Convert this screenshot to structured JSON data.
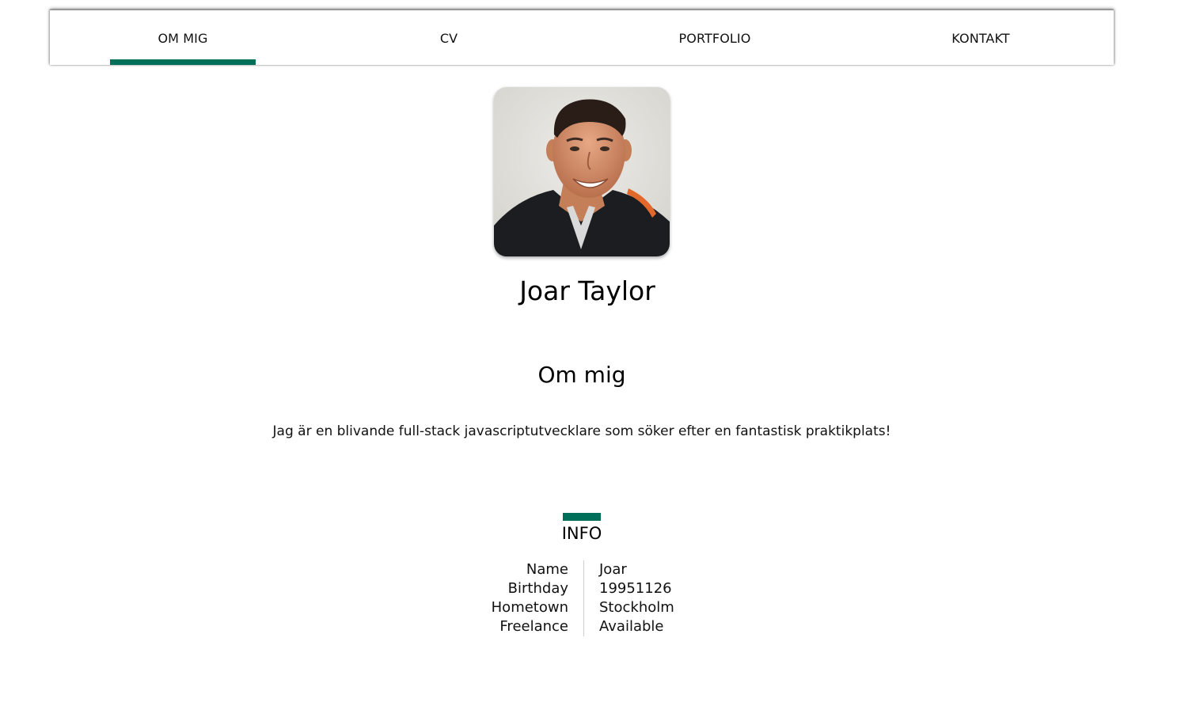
{
  "nav": {
    "items": [
      {
        "label": "OM MIG",
        "active": true
      },
      {
        "label": "CV",
        "active": false
      },
      {
        "label": "PORTFOLIO",
        "active": false
      },
      {
        "label": "KONTAKT",
        "active": false
      }
    ],
    "accent_color": "#006f5a"
  },
  "profile": {
    "name": "Joar Taylor",
    "avatar_icon": "profile-photo"
  },
  "about": {
    "title": "Om mig",
    "text": "Jag är en blivande full-stack javascriptutvecklare som söker efter en fantastisk praktikplats!"
  },
  "info": {
    "title": "INFO",
    "rows": [
      {
        "key": "Name",
        "value": "Joar"
      },
      {
        "key": "Birthday",
        "value": "19951126"
      },
      {
        "key": "Hometown",
        "value": "Stockholm"
      },
      {
        "key": "Freelance",
        "value": "Available"
      }
    ]
  }
}
